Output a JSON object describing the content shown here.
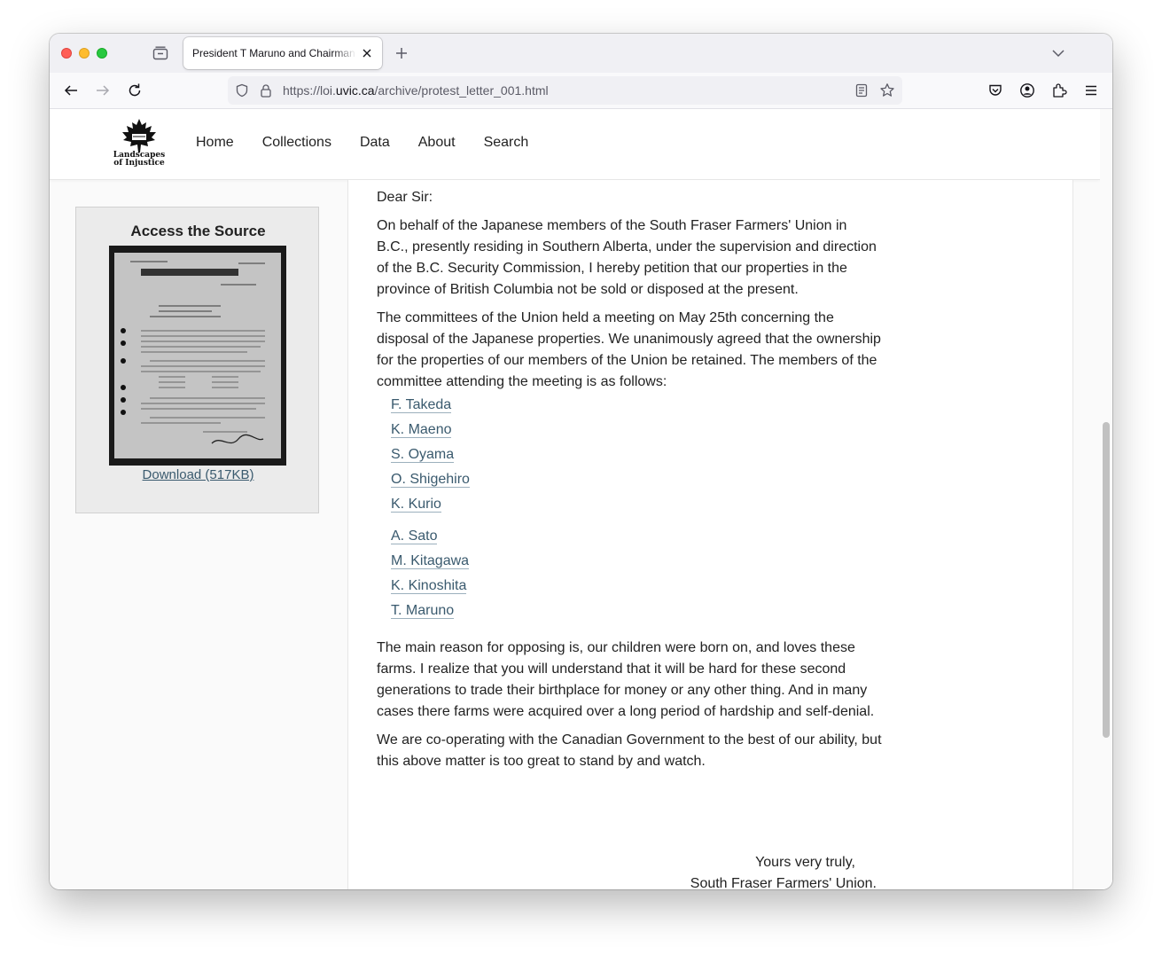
{
  "browser": {
    "tab_title": "President T Maruno and Chairman K Kinoshita to Custodian",
    "url_prefix": "https://loi.",
    "url_domain": "uvic.ca",
    "url_path": "/archive/protest_letter_001.html"
  },
  "site": {
    "logo_text_line1": "Landscapes",
    "logo_text_line2": "of Injustice",
    "nav": [
      "Home",
      "Collections",
      "Data",
      "About",
      "Search"
    ]
  },
  "sidebar": {
    "title": "Access the Source",
    "download_label": "Download (517KB)"
  },
  "letter": {
    "salutation": "Dear Sir:",
    "para1": "On behalf of the Japanese members of the South Fraser Farmers' Union in B.C., presently residing in Southern Alberta, under the supervision and direction of the B.C. Security Commission, I hereby petition that our properties in the province of British Columbia not be sold or disposed at the present.",
    "para2": "The committees of the Union held a meeting on May 25th concerning the disposal of the Japanese properties. We unanimously agreed that the ownership for the properties of our members of the Union be retained. The members of the committee attending the meeting is as follows:",
    "members": [
      "F. Takeda",
      "K. Maeno",
      "S. Oyama",
      "O. Shigehiro",
      "K. Kurio",
      "A. Sato",
      "M. Kitagawa",
      "K. Kinoshita",
      "T. Maruno"
    ],
    "para3": "The main reason for opposing is, our children were born on, and loves these farms. I realize that you will understand that it will be hard for these second generations to trade their birthplace for money or any other thing. And in many cases there farms were acquired over a long period of hardship and self-denial.",
    "para4": "We are co-operating with the Canadian Government to the best of our ability, but this above matter is too great to stand by and watch.",
    "closing": "Yours very truly,",
    "signature_org": "South Fraser Farmers' Union."
  }
}
